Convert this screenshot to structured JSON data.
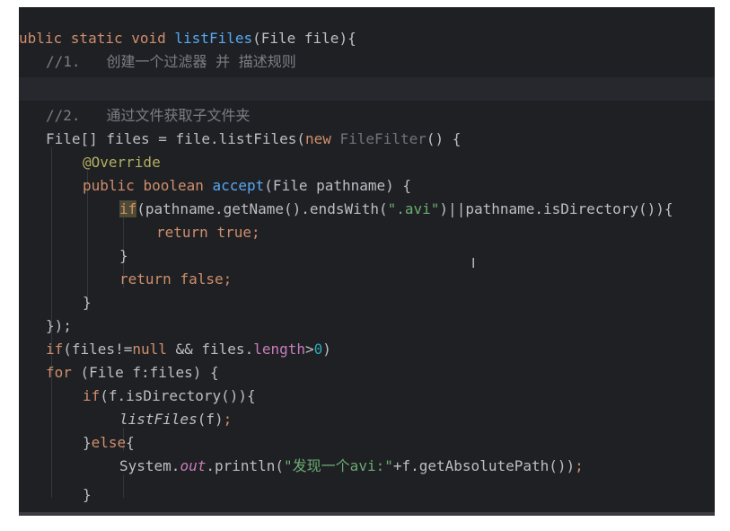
{
  "code_lines": [
    {
      "t": [
        [
          "ublic ",
          "kw"
        ],
        [
          "static ",
          "kw"
        ],
        [
          "void ",
          "kw"
        ],
        [
          "listFiles",
          "fn"
        ],
        [
          "(File file){",
          ""
        ]
      ]
    },
    {
      "t": [
        [
          "//1.   ",
          "cm"
        ],
        [
          "创建一个过滤器 并 描述规则",
          "cm"
        ]
      ]
    },
    {
      "t": [
        [
          "",
          ""
        ]
      ]
    },
    {
      "t": [
        [
          "//2.   ",
          "cm"
        ],
        [
          "通过文件获取子文件夹",
          "cm"
        ]
      ]
    },
    {
      "t": [
        [
          "File[] files = file.listFiles(",
          ""
        ],
        [
          "new ",
          "kw"
        ],
        [
          "FileFilter",
          "dim"
        ],
        [
          "() {",
          ""
        ]
      ]
    },
    {
      "t": [
        [
          "@Override",
          "an"
        ]
      ]
    },
    {
      "t": [
        [
          "public ",
          "kw"
        ],
        [
          "boolean ",
          "kw"
        ],
        [
          "accept",
          "fn"
        ],
        [
          "(File pathname) {",
          ""
        ]
      ]
    },
    {
      "t": [
        [
          "if",
          "kw hl"
        ],
        [
          "(pathname.getName().endsWith(",
          ""
        ],
        [
          "\".avi\"",
          "st"
        ],
        [
          ")||pathname.isDirectory()){",
          ""
        ]
      ]
    },
    {
      "t": [
        [
          "return ",
          "kw"
        ],
        [
          "true",
          "kw"
        ],
        [
          ";",
          "kw"
        ]
      ]
    },
    {
      "t": [
        [
          "}",
          ""
        ]
      ]
    },
    {
      "t": [
        [
          "return ",
          "kw"
        ],
        [
          "false",
          "kw"
        ],
        [
          ";",
          "kw"
        ]
      ]
    },
    {
      "t": [
        [
          "}",
          ""
        ]
      ]
    },
    {
      "t": [
        [
          "});",
          ""
        ]
      ]
    },
    {
      "t": [
        [
          "if",
          "kw"
        ],
        [
          "(files!=",
          ""
        ],
        [
          "null ",
          "kw"
        ],
        [
          "&& files.",
          ""
        ],
        [
          "length",
          "fld"
        ],
        [
          ">",
          ""
        ],
        [
          "0",
          "num"
        ],
        [
          ")",
          ""
        ]
      ]
    },
    {
      "t": [
        [
          "for ",
          "kw"
        ],
        [
          "(File f:files) {",
          ""
        ]
      ]
    },
    {
      "t": [
        [
          "if",
          "kw"
        ],
        [
          "(f.isDirectory()){",
          ""
        ]
      ]
    },
    {
      "t": [
        [
          "listFiles",
          "ital"
        ],
        [
          "(f)",
          ""
        ],
        [
          ";",
          "kw"
        ]
      ]
    },
    {
      "t": [
        [
          "}",
          ""
        ],
        [
          "else",
          "kw"
        ],
        [
          "{",
          ""
        ]
      ]
    },
    {
      "t": [
        [
          "System.",
          ""
        ],
        [
          "out",
          "fld ital"
        ],
        [
          ".println(",
          ""
        ],
        [
          "\"发现一个avi:\"",
          "st"
        ],
        [
          "+f.getAbsolutePath())",
          ""
        ],
        [
          ";",
          "kw"
        ]
      ]
    },
    {
      "t": [
        [
          "}",
          ""
        ]
      ]
    }
  ],
  "cursor_glyph": "I"
}
